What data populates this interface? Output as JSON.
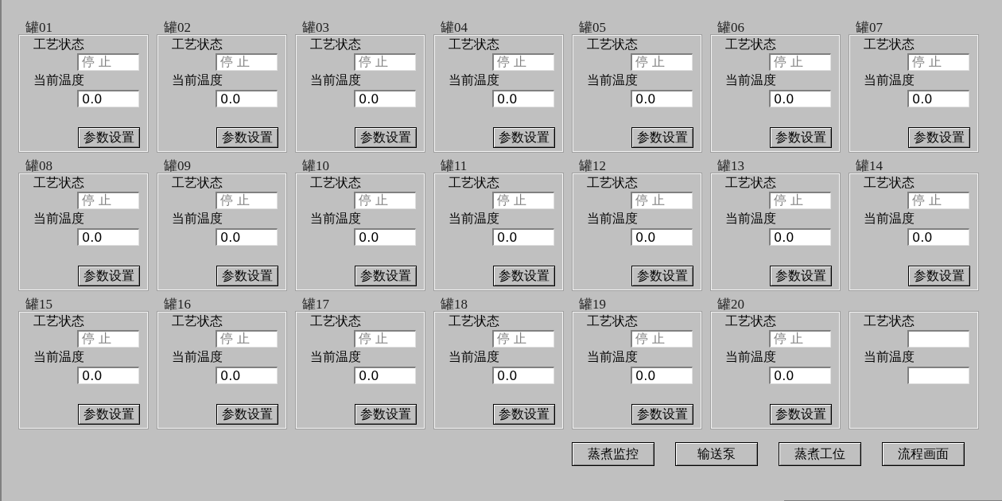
{
  "tanks": [
    {
      "title": "罐01",
      "status_label": "工艺状态",
      "status": "停 止",
      "temp_label": "当前温度",
      "temperature": "0.0",
      "button": "参数设置"
    },
    {
      "title": "罐02",
      "status_label": "工艺状态",
      "status": "停 止",
      "temp_label": "当前温度",
      "temperature": "0.0",
      "button": "参数设置"
    },
    {
      "title": "罐03",
      "status_label": "工艺状态",
      "status": "停 止",
      "temp_label": "当前温度",
      "temperature": "0.0",
      "button": "参数设置"
    },
    {
      "title": "罐04",
      "status_label": "工艺状态",
      "status": "停 止",
      "temp_label": "当前温度",
      "temperature": "0.0",
      "button": "参数设置"
    },
    {
      "title": "罐05",
      "status_label": "工艺状态",
      "status": "停 止",
      "temp_label": "当前温度",
      "temperature": "0.0",
      "button": "参数设置"
    },
    {
      "title": "罐06",
      "status_label": "工艺状态",
      "status": "停 止",
      "temp_label": "当前温度",
      "temperature": "0.0",
      "button": "参数设置"
    },
    {
      "title": "罐07",
      "status_label": "工艺状态",
      "status": "停 止",
      "temp_label": "当前温度",
      "temperature": "0.0",
      "button": "参数设置"
    },
    {
      "title": "罐08",
      "status_label": "工艺状态",
      "status": "停 止",
      "temp_label": "当前温度",
      "temperature": "0.0",
      "button": "参数设置"
    },
    {
      "title": "罐09",
      "status_label": "工艺状态",
      "status": "停 止",
      "temp_label": "当前温度",
      "temperature": "0.0",
      "button": "参数设置"
    },
    {
      "title": "罐10",
      "status_label": "工艺状态",
      "status": "停 止",
      "temp_label": "当前温度",
      "temperature": "0.0",
      "button": "参数设置"
    },
    {
      "title": "罐11",
      "status_label": "工艺状态",
      "status": "停 止",
      "temp_label": "当前温度",
      "temperature": "0.0",
      "button": "参数设置"
    },
    {
      "title": "罐12",
      "status_label": "工艺状态",
      "status": "停 止",
      "temp_label": "当前温度",
      "temperature": "0.0",
      "button": "参数设置"
    },
    {
      "title": "罐13",
      "status_label": "工艺状态",
      "status": "停 止",
      "temp_label": "当前温度",
      "temperature": "0.0",
      "button": "参数设置"
    },
    {
      "title": "罐14",
      "status_label": "工艺状态",
      "status": "停 止",
      "temp_label": "当前温度",
      "temperature": "0.0",
      "button": "参数设置"
    },
    {
      "title": "罐15",
      "status_label": "工艺状态",
      "status": "停 止",
      "temp_label": "当前温度",
      "temperature": "0.0",
      "button": "参数设置"
    },
    {
      "title": "罐16",
      "status_label": "工艺状态",
      "status": "停 止",
      "temp_label": "当前温度",
      "temperature": "0.0",
      "button": "参数设置"
    },
    {
      "title": "罐17",
      "status_label": "工艺状态",
      "status": "停 止",
      "temp_label": "当前温度",
      "temperature": "0.0",
      "button": "参数设置"
    },
    {
      "title": "罐18",
      "status_label": "工艺状态",
      "status": "停 止",
      "temp_label": "当前温度",
      "temperature": "0.0",
      "button": "参数设置"
    },
    {
      "title": "罐19",
      "status_label": "工艺状态",
      "status": "停 止",
      "temp_label": "当前温度",
      "temperature": "0.0",
      "button": "参数设置"
    },
    {
      "title": "罐20",
      "status_label": "工艺状态",
      "status": "停 止",
      "temp_label": "当前温度",
      "temperature": "0.0",
      "button": "参数设置"
    },
    {
      "status_label": "工艺状态",
      "temp_label": "当前温度"
    }
  ],
  "nav_buttons": [
    "蒸煮监控",
    "输送泵",
    "蒸煮工位",
    "流程画面"
  ]
}
